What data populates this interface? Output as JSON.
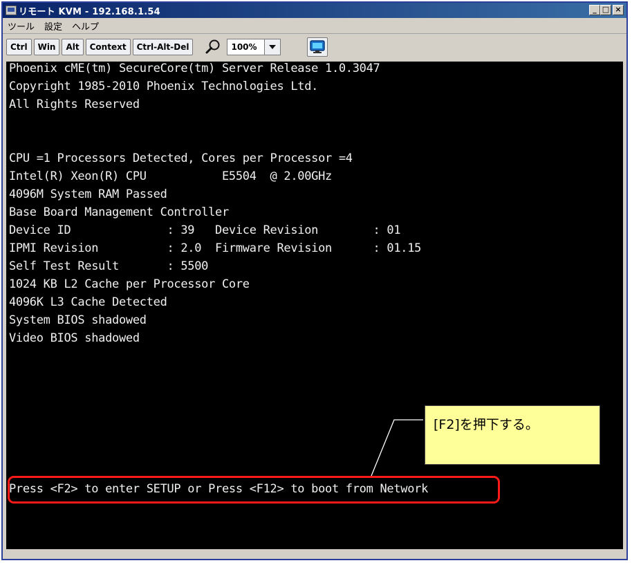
{
  "window": {
    "title": "リモート KVM - 192.168.1.54",
    "controls": {
      "minimize": "_",
      "maximize": "□",
      "close": "×"
    }
  },
  "menu": {
    "items": [
      "ツール",
      "設定",
      "ヘルプ"
    ]
  },
  "toolbar": {
    "keys": [
      "Ctrl",
      "Win",
      "Alt",
      "Context",
      "Ctrl-Alt-Del"
    ],
    "zoom_icon": "magnifier-icon",
    "zoom_value": "100%",
    "screen_icon": "monitor-icon"
  },
  "console": {
    "lines": [
      "Phoenix cME(tm) SecureCore(tm) Server Release 1.0.3047",
      "Copyright 1985-2010 Phoenix Technologies Ltd.",
      "All Rights Reserved",
      "",
      "",
      "CPU =1 Processors Detected, Cores per Processor =4",
      "Intel(R) Xeon(R) CPU           E5504  @ 2.00GHz",
      "4096M System RAM Passed",
      "Base Board Management Controller",
      "Device ID              : 39   Device Revision        : 01",
      "IPMI Revision          : 2.0  Firmware Revision      : 01.15",
      "Self Test Result       : 5500",
      "1024 KB L2 Cache per Processor Core",
      "4096K L3 Cache Detected",
      "System BIOS shadowed",
      "Video BIOS shadowed"
    ],
    "prompt": "Press <F2> to enter SETUP or Press <F12> to boot from Network"
  },
  "annotation": {
    "callout_text": "[F2]を押下する。",
    "highlight_color": "#ff1a1a",
    "callout_color": "#ffff99"
  }
}
